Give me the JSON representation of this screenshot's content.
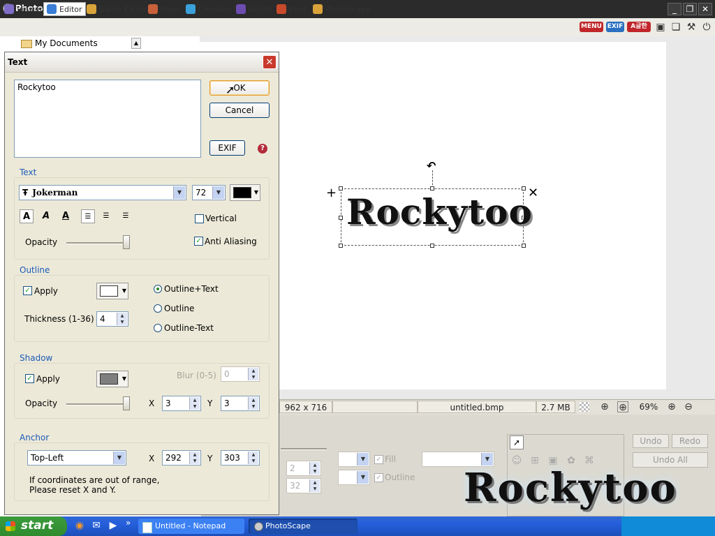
{
  "app": {
    "title": "PhotoScape"
  },
  "tabs": [
    {
      "label": "Viewer",
      "color": "#7f6cc8"
    },
    {
      "label": "Editor",
      "color": "#3a7dd6"
    },
    {
      "label": "Batch Editor",
      "color": "#d9a33a"
    },
    {
      "label": "Page",
      "color": "#c9603a"
    },
    {
      "label": "Combine",
      "color": "#3aa0d9"
    },
    {
      "label": "AniGif",
      "color": "#6d4cb0"
    },
    {
      "label": "Print",
      "color": "#c94a2b"
    },
    {
      "label": "PhotoScape",
      "color": "#d9a33a"
    }
  ],
  "toolbar_badges": {
    "menu": "MENU",
    "exif": "EXIF",
    "lang": "A글한"
  },
  "tree": {
    "item": "My Documents"
  },
  "dialog": {
    "title": "Text",
    "text_value": "Rockytoo",
    "ok": "OK",
    "cancel": "Cancel",
    "exif": "EXIF",
    "help": "?",
    "text_section": {
      "label": "Text",
      "font": "Jokerman",
      "font_icon": "Ŧ",
      "size": "72",
      "color": "#000000",
      "bold": "A",
      "italic": "A",
      "underline": "A",
      "vertical": "Vertical",
      "anti_aliasing": "Anti Aliasing",
      "opacity": "Opacity"
    },
    "outline_section": {
      "label": "Outline",
      "apply": "Apply",
      "color": "#ffffff",
      "thickness_label": "Thickness (1-36)",
      "thickness": "4",
      "opt1": "Outline+Text",
      "opt2": "Outline",
      "opt3": "Outline-Text"
    },
    "shadow_section": {
      "label": "Shadow",
      "apply": "Apply",
      "color": "#7f7f7f",
      "blur_label": "Blur (0-5)",
      "blur": "0",
      "opacity": "Opacity",
      "x_label": "X",
      "x": "3",
      "y_label": "Y",
      "y": "3"
    },
    "anchor_section": {
      "label": "Anchor",
      "position": "Top-Left",
      "x_label": "X",
      "x": "292",
      "y_label": "Y",
      "y": "303",
      "note_line1": "If coordinates are out of range,",
      "note_line2": "Please reset X and Y."
    }
  },
  "canvas_text": "Rockytoo",
  "status": {
    "dimensions": "962 x 716",
    "filename": "untitled.bmp",
    "filesize": "2.7 MB",
    "zoom": "69%"
  },
  "bottom_panel": {
    "spin1": "2",
    "spin2": "32",
    "fill": "Fill",
    "outline": "Outline",
    "undo": "Undo",
    "redo": "Redo",
    "undo_all": "Undo All"
  },
  "watermark": "Rockytoo",
  "taskbar": {
    "start": "start",
    "task1": "Untitled - Notepad",
    "task2": "PhotoScape"
  }
}
